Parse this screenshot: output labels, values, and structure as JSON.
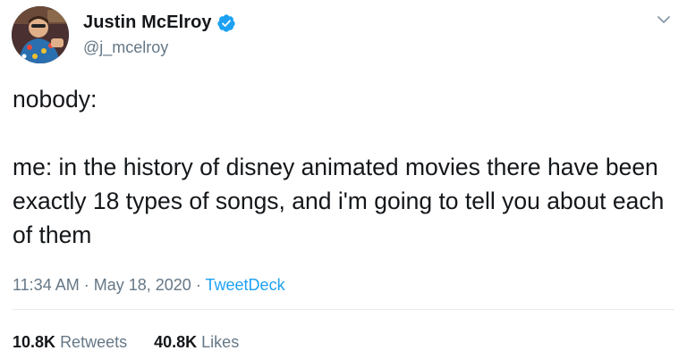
{
  "author": {
    "display_name": "Justin McElroy",
    "handle": "@j_mcelroy",
    "verified": true
  },
  "tweet": {
    "text": "nobody:\n\nme: in the history of disney animated movies there have been exactly 18 types of songs, and i'm going to tell you about each of them"
  },
  "meta": {
    "time": "11:34 AM",
    "date": "May 18, 2020",
    "separator": "·",
    "source": "TweetDeck"
  },
  "stats": {
    "retweets_count": "10.8K",
    "retweets_label": "Retweets",
    "likes_count": "40.8K",
    "likes_label": "Likes"
  },
  "colors": {
    "accent": "#1da1f2",
    "secondary_text": "#657786",
    "primary_text": "#14171a",
    "divider": "#e6ecf0"
  },
  "icons": {
    "verified": "verified-badge-icon",
    "chevron": "chevron-down-icon"
  }
}
